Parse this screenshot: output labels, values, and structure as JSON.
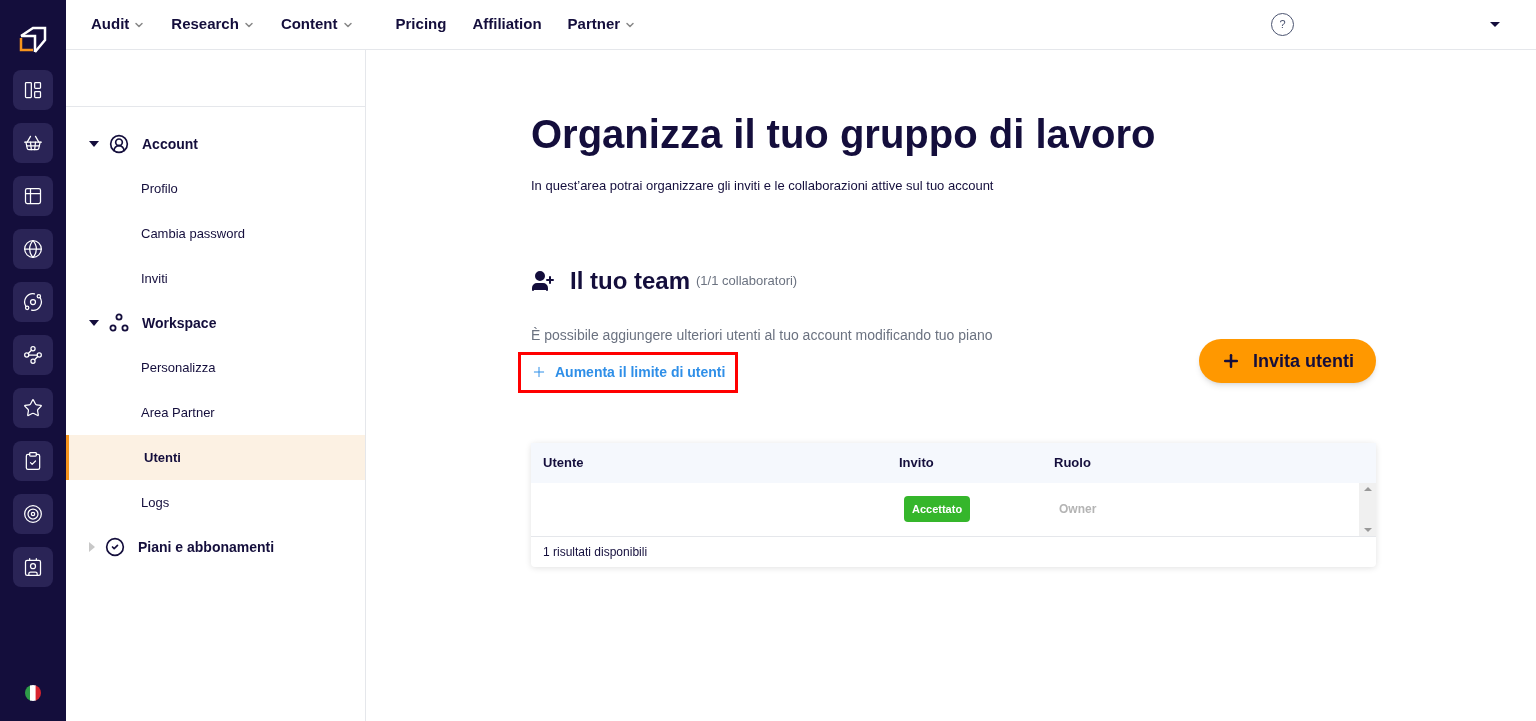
{
  "topnav": [
    {
      "label": "Audit",
      "dropdown": true
    },
    {
      "label": "Research",
      "dropdown": true
    },
    {
      "label": "Content",
      "dropdown": true
    },
    {
      "label": "Pricing",
      "dropdown": false
    },
    {
      "label": "Affiliation",
      "dropdown": false
    },
    {
      "label": "Partner",
      "dropdown": true
    }
  ],
  "help": "?",
  "sidebar": {
    "sections": [
      {
        "label": "Account",
        "expanded": true,
        "children": [
          {
            "label": "Profilo",
            "selected": false
          },
          {
            "label": "Cambia password",
            "selected": false
          },
          {
            "label": "Inviti",
            "selected": false
          }
        ]
      },
      {
        "label": "Workspace",
        "expanded": true,
        "children": [
          {
            "label": "Personalizza",
            "selected": false
          },
          {
            "label": "Area Partner",
            "selected": false
          },
          {
            "label": "Utenti",
            "selected": true
          },
          {
            "label": "Logs",
            "selected": false
          }
        ]
      },
      {
        "label": "Piani e abbonamenti",
        "expanded": false
      }
    ]
  },
  "page": {
    "title": "Organizza il tuo gruppo di lavoro",
    "subtitle": "In quest’area potrai organizzare gli inviti e le collaborazioni attive sul tuo account",
    "team_title": "Il tuo team",
    "team_count": "(1/1 collaboratori)",
    "info": "È possibile aggiungere ulteriori utenti al tuo account modificando tuo piano",
    "increase_link": {
      "label": "Aumenta il limite di utenti",
      "highlighted": true
    },
    "invite_button": "Invita utenti",
    "table": {
      "columns": [
        "Utente",
        "Invito",
        "Ruolo"
      ],
      "rows": [
        {
          "invite": "Accettato",
          "role": "Owner"
        }
      ],
      "footer": "1 risultati disponibili"
    }
  }
}
